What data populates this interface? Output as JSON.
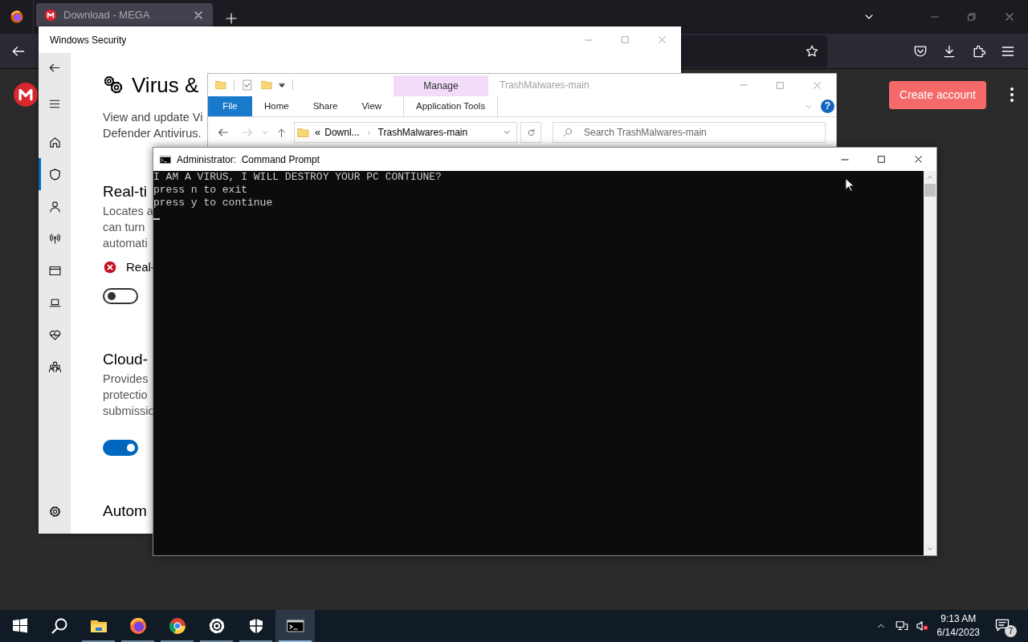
{
  "browser": {
    "tabs": [
      {
        "label": "Download - MEGA",
        "selected": true
      }
    ],
    "create_account": "Create account"
  },
  "security": {
    "title": "Windows Security",
    "nav": [
      {
        "kind": "back",
        "selected": false
      },
      {
        "kind": "menu",
        "selected": false
      },
      {
        "kind": "home",
        "selected": false
      },
      {
        "kind": "shield",
        "selected": true
      },
      {
        "kind": "account",
        "selected": false
      },
      {
        "kind": "network",
        "selected": false
      },
      {
        "kind": "app",
        "selected": false
      },
      {
        "kind": "device",
        "selected": false
      },
      {
        "kind": "health",
        "selected": false
      },
      {
        "kind": "family",
        "selected": false
      },
      {
        "kind": "settings",
        "selected": false
      }
    ],
    "heading": "Virus &",
    "intro": [
      "View and update Vi",
      "Defender Antivirus."
    ],
    "sections": [
      {
        "title": "Real-ti",
        "lines": [
          "Locates a",
          "can turn",
          "automati"
        ],
        "status": "Real-",
        "toggle_on": false
      },
      {
        "title": "Cloud-",
        "lines": [
          "Provides",
          "protectio",
          "submissio"
        ],
        "toggle_on": true
      },
      {
        "title": "Autom"
      }
    ]
  },
  "explorer": {
    "title": "TrashMalwares-main",
    "context_tab": "Manage",
    "tabs": [
      {
        "label": "File",
        "kind": "file"
      },
      {
        "label": "Home",
        "kind": "tab"
      },
      {
        "label": "Share",
        "kind": "tab"
      },
      {
        "label": "View",
        "kind": "tab"
      },
      {
        "label": "Application Tools",
        "kind": "context"
      }
    ],
    "help": "?",
    "path_prefix": "«",
    "path": [
      "Downl...",
      "TrashMalwares-main"
    ],
    "search_placeholder": "Search TrashMalwares-main"
  },
  "cmd": {
    "title": "Administrator:  Command Prompt",
    "lines": [
      "I AM A VIRUS, I WILL DESTROY YOUR PC CONTIUNE?",
      "press n to exit",
      "press y to continue"
    ]
  },
  "taskbar": {
    "apps": [
      {
        "kind": "start",
        "running": false,
        "selected": false
      },
      {
        "kind": "search",
        "running": false,
        "selected": false
      },
      {
        "kind": "explorer",
        "running": true,
        "selected": false
      },
      {
        "kind": "firefox",
        "running": true,
        "selected": false
      },
      {
        "kind": "chrome",
        "running": true,
        "selected": false
      },
      {
        "kind": "settings",
        "running": true,
        "selected": false
      },
      {
        "kind": "security",
        "running": true,
        "selected": false
      },
      {
        "kind": "cmd",
        "running": true,
        "selected": true
      }
    ],
    "time": "9:13 AM",
    "date": "6/14/2023",
    "notifications": "7"
  }
}
